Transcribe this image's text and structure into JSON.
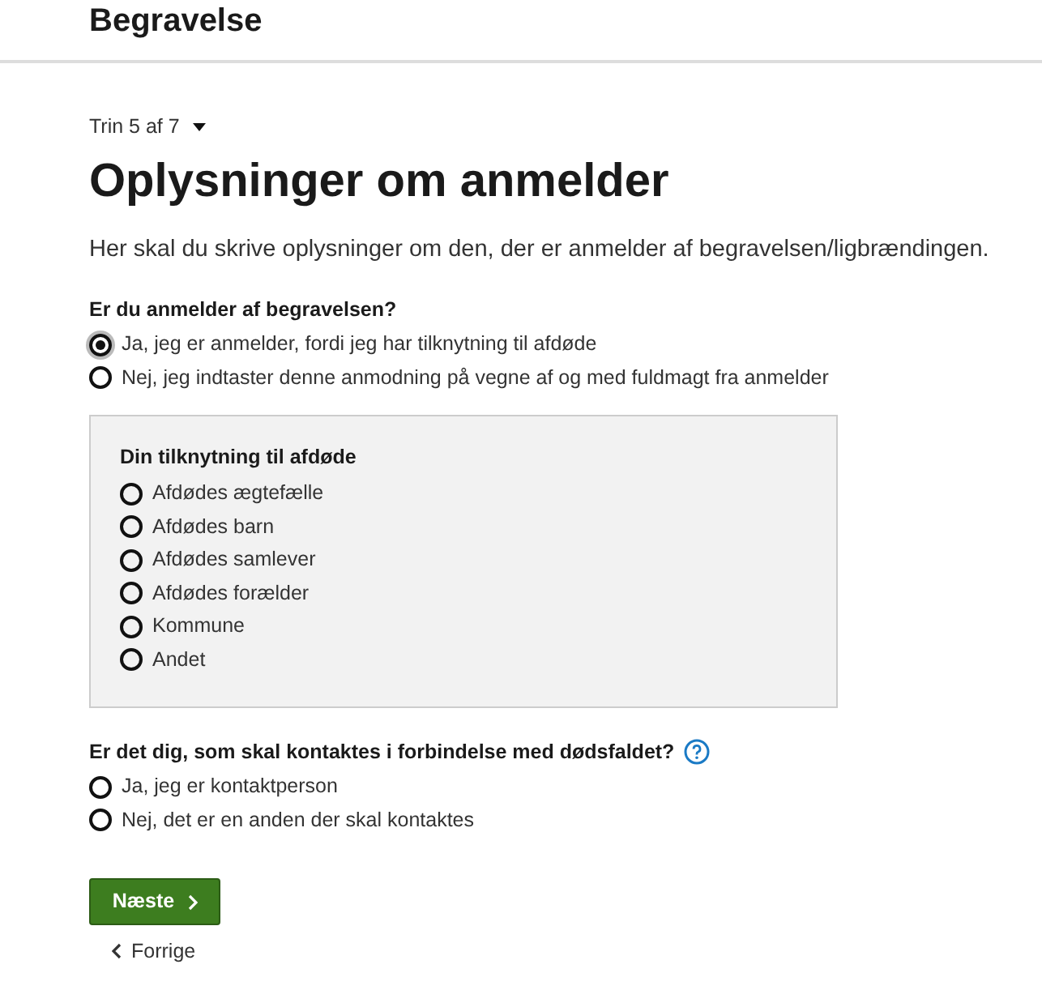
{
  "header": {
    "title": "Begravelse"
  },
  "step": {
    "label": "Trin 5 af 7"
  },
  "heading": "Oplysninger om anmelder",
  "intro": "Her skal du skrive oplysninger om den, der er anmelder af begravelsen/ligbrændingen.",
  "question_1": {
    "label": "Er du anmelder af begravelsen?",
    "options": [
      {
        "label": "Ja, jeg er anmelder, fordi jeg har tilknytning til afdøde",
        "selected": true
      },
      {
        "label": "Nej, jeg indtaster denne anmodning på vegne af og med fuldmagt fra anmelder",
        "selected": false
      }
    ]
  },
  "relation_panel": {
    "label": "Din tilknytning til afdøde",
    "options": [
      {
        "label": "Afdødes ægtefælle",
        "selected": false
      },
      {
        "label": "Afdødes barn",
        "selected": false
      },
      {
        "label": "Afdødes samlever",
        "selected": false
      },
      {
        "label": "Afdødes forælder",
        "selected": false
      },
      {
        "label": "Kommune",
        "selected": false
      },
      {
        "label": "Andet",
        "selected": false
      }
    ]
  },
  "question_2": {
    "label": "Er det dig, som skal kontaktes i forbindelse med dødsfaldet?",
    "options": [
      {
        "label": "Ja, jeg er kontaktperson",
        "selected": false
      },
      {
        "label": "Nej, det er en anden der skal kontaktes",
        "selected": false
      }
    ]
  },
  "next_button": "Næste",
  "back_link": "Forrige"
}
